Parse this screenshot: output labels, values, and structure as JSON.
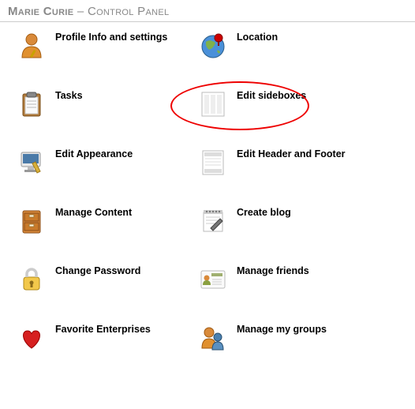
{
  "header": {
    "user": "Marie Curie",
    "separator": " – ",
    "title": "Control Panel"
  },
  "items": [
    {
      "label": "Profile Info and settings",
      "icon": "profile-icon"
    },
    {
      "label": "Location",
      "icon": "globe-icon"
    },
    {
      "label": "Tasks",
      "icon": "clipboard-icon"
    },
    {
      "label": "Edit sideboxes",
      "icon": "sidebox-icon"
    },
    {
      "label": "Edit Appearance",
      "icon": "appearance-icon"
    },
    {
      "label": "Edit Header and Footer",
      "icon": "header-footer-icon"
    },
    {
      "label": "Manage Content",
      "icon": "drawer-icon"
    },
    {
      "label": "Create blog",
      "icon": "notepad-icon"
    },
    {
      "label": "Change Password",
      "icon": "lock-icon"
    },
    {
      "label": "Manage friends",
      "icon": "friends-card-icon"
    },
    {
      "label": "Favorite Enterprises",
      "icon": "heart-icon"
    },
    {
      "label": "Manage my groups",
      "icon": "groups-icon"
    }
  ],
  "highlight": {
    "target_index": 3,
    "note": "red oval around Edit sideboxes"
  }
}
